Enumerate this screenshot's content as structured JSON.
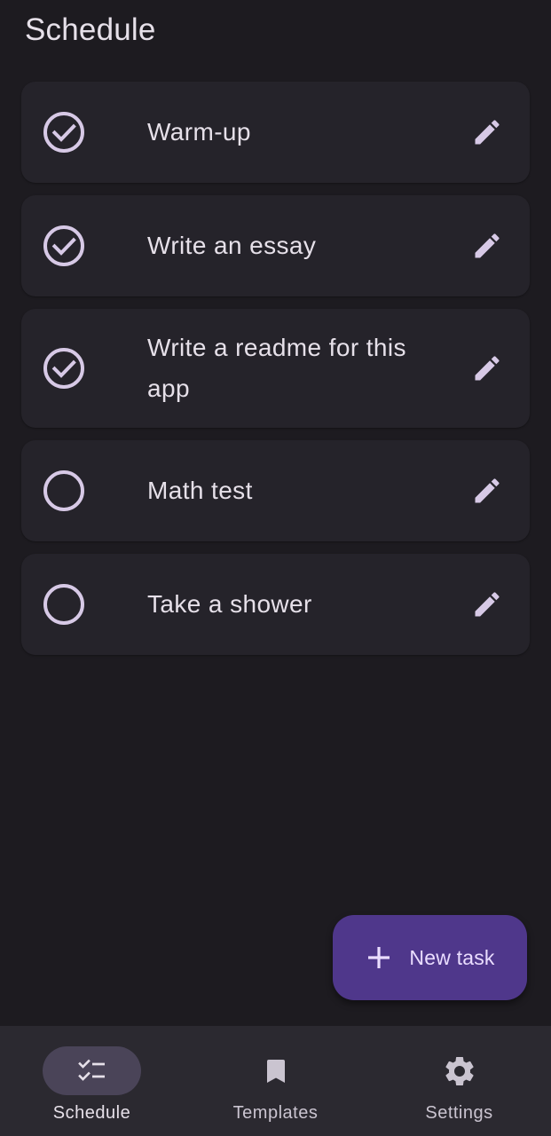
{
  "page": {
    "title": "Schedule"
  },
  "tasks": [
    {
      "label": "Warm-up",
      "completed": true
    },
    {
      "label": "Write an essay",
      "completed": true
    },
    {
      "label": "Write a readme for this app",
      "completed": true
    },
    {
      "label": "Math test",
      "completed": false
    },
    {
      "label": "Take a shower",
      "completed": false
    }
  ],
  "fab": {
    "label": "New task",
    "icon": "plus-icon"
  },
  "bottom_nav": {
    "items": [
      {
        "label": "Schedule",
        "icon": "checklist-icon",
        "active": true
      },
      {
        "label": "Templates",
        "icon": "bookmark-icon",
        "active": false
      },
      {
        "label": "Settings",
        "icon": "gear-icon",
        "active": false
      }
    ]
  },
  "colors": {
    "background": "#1d1b20",
    "card": "#25232a",
    "fab": "#4f378b",
    "nav_bar": "#2b2930",
    "nav_indicator": "#4a4458",
    "icon": "#d7c9e6"
  }
}
